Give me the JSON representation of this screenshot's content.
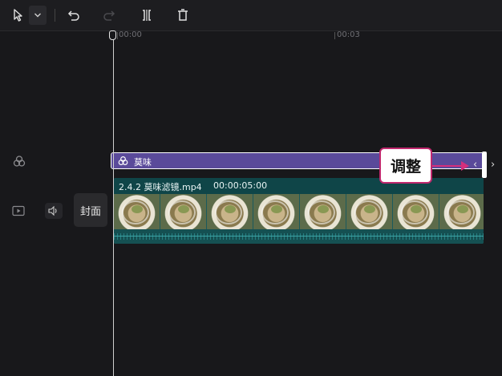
{
  "toolbar": {
    "select_icon": "cursor-icon",
    "dropdown_icon": "chevron-down-icon",
    "undo_icon": "undo-icon",
    "redo_icon": "redo-icon",
    "split_icon": "split-icon",
    "delete_icon": "trash-icon"
  },
  "ruler": {
    "start_label": "00:00",
    "mark_label": "00:03"
  },
  "tracks": {
    "filter": {
      "icon": "filter-icon",
      "label": "莫味"
    },
    "video": {
      "icon": "video-track-icon",
      "audio_icon": "speaker-icon",
      "cover_label": "封面",
      "file_name": "2.4.2  莫味滤镜.mp4",
      "duration": "00:00:05:00"
    }
  },
  "annotation": {
    "label": "调整",
    "color": "#c0286e"
  },
  "handle_arrows": "〈〉"
}
